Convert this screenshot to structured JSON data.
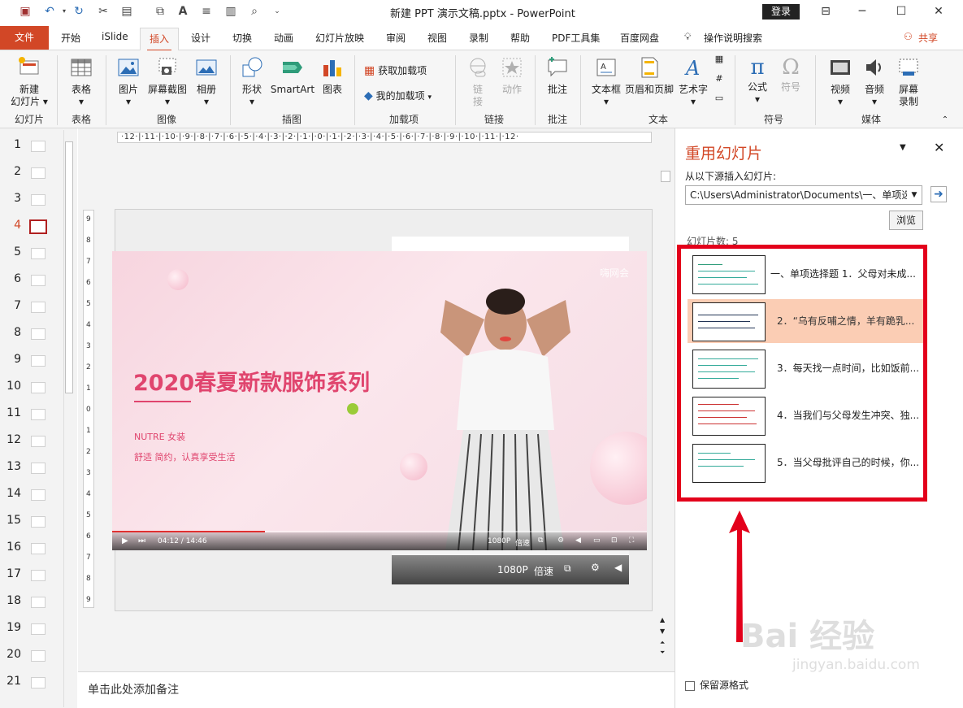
{
  "titlebar": {
    "doc_title": "新建 PPT 演示文稿.pptx  -  PowerPoint",
    "login": "登录"
  },
  "tabs": {
    "file": "文件",
    "items": [
      "开始",
      "iSlide",
      "插入",
      "设计",
      "切换",
      "动画",
      "幻灯片放映",
      "审阅",
      "视图",
      "录制",
      "帮助",
      "PDF工具集",
      "百度网盘",
      "操作说明搜索"
    ],
    "share": "共享"
  },
  "ribbon": {
    "new_slide": "新建\n幻灯片",
    "new_slide_l1": "新建",
    "new_slide_l2": "幻灯片",
    "table": "表格",
    "picture": "图片",
    "screenshot": "屏幕截图",
    "album": "相册",
    "shape": "形状",
    "smartart": "SmartArt",
    "chart": "图表",
    "get_addins": "获取加载项",
    "my_addins": "我的加载项",
    "link": "链\n接",
    "link_l1": "链",
    "link_l2": "接",
    "action": "动作",
    "comment": "批注",
    "textbox": "文本框",
    "header_footer": "页眉和页脚",
    "wordart": "艺术字",
    "equation": "公式",
    "symbol": "符号",
    "video": "视频",
    "audio": "音频",
    "screen_record_l1": "屏幕",
    "screen_record_l2": "录制",
    "groups": {
      "slides": "幻灯片",
      "tables": "表格",
      "images": "图像",
      "illustrations": "插图",
      "addins": "加载项",
      "links": "链接",
      "comments": "批注",
      "text": "文本",
      "symbols": "符号",
      "media": "媒体"
    }
  },
  "thumbnails": [
    "1",
    "2",
    "3",
    "4",
    "5",
    "6",
    "7",
    "8",
    "9",
    "10",
    "11",
    "12",
    "13",
    "14",
    "15",
    "16",
    "17",
    "18",
    "19",
    "20",
    "21"
  ],
  "active_slide": 4,
  "ruler": {
    "h": "·12·|·11·|·10·|·9·|·8·|·7·|·6·|·5·|·4·|·3·|·2·|·1·|·0·|·1·|·2·|·3·|·4·|·5·|·6·|·7·|·8·|·9·|·10·|·11·|·12·",
    "v": [
      "9",
      "8",
      "7",
      "6",
      "5",
      "4",
      "3",
      "2",
      "1",
      "0",
      "1",
      "2",
      "3",
      "4",
      "5",
      "6",
      "7",
      "8",
      "9"
    ]
  },
  "slide": {
    "video_title": "2020春夏新款服饰系列",
    "video_sub1": "NUTRE 女装",
    "video_sub2": "舒适 简约，认真享受生活",
    "watermark": "嗨网会",
    "ctrl_time": "04:12 / 14:46",
    "ctrl_quality": "1080P",
    "ctrl_speed": "倍速",
    "progress": 0.285,
    "back_quality": "1080P",
    "back_speed": "倍速"
  },
  "notes_placeholder": "单击此处添加备注",
  "reuse": {
    "title": "重用幻灯片",
    "source_label": "从以下源插入幻灯片:",
    "path": "C:\\Users\\Administrator\\Documents\\一、单项选",
    "browse": "浏览",
    "count": "幻灯片数: 5",
    "items": [
      "一、单项选择题   1．父母对未成...",
      "2．“乌有反哺之情，羊有跪乳...",
      "3．每天找一点时间，比如饭前...",
      "4．当我们与父母发生冲突、独...",
      "5．当父母批评自己的时候，你..."
    ],
    "selected_index": 1,
    "keep_format": "保留源格式"
  },
  "watermark": {
    "brand": "Bai  经验",
    "url": "jingyan.baidu.com"
  },
  "colors": {
    "accent": "#d24726",
    "highlight": "#e3001b",
    "selected_item": "#fbcdb4",
    "video_title": "#e0456e"
  }
}
